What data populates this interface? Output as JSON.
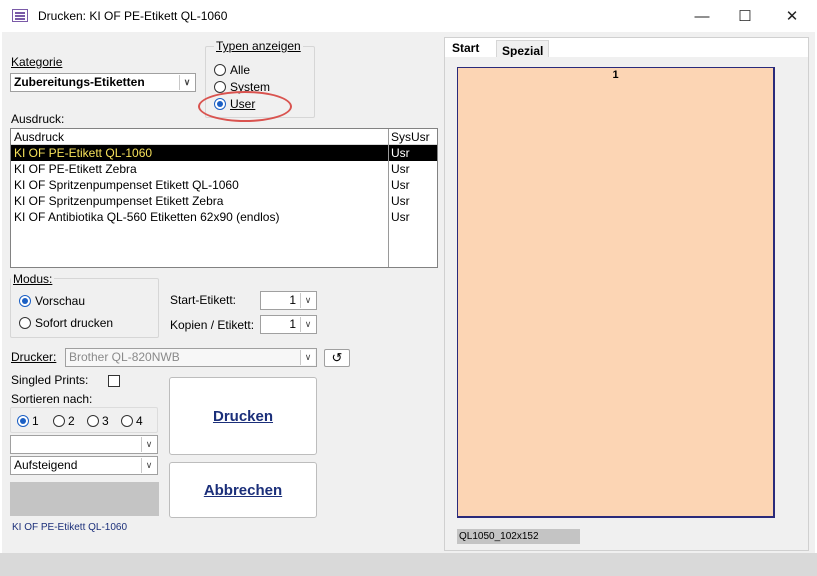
{
  "window": {
    "title": "Drucken: KI OF PE-Etikett QL-1060",
    "minimize_glyph": "—",
    "maximize_glyph": "☐",
    "close_glyph": "✕"
  },
  "kategorie": {
    "label": "Kategorie",
    "value": "Zubereitungs-Etiketten"
  },
  "typen": {
    "label": "Typen anzeigen",
    "options": [
      "Alle",
      "System",
      "User"
    ],
    "selected": "User"
  },
  "ausdruck": {
    "label": "Ausdruck:",
    "columns": [
      "Ausdruck",
      "SysUsr"
    ],
    "rows": [
      {
        "name": "KI OF PE-Etikett QL-1060",
        "sys": "Usr"
      },
      {
        "name": "KI OF PE-Etikett Zebra",
        "sys": "Usr"
      },
      {
        "name": "KI OF Spritzenpumpenset Etikett QL-1060",
        "sys": "Usr"
      },
      {
        "name": "KI OF Spritzenpumpenset Etikett Zebra",
        "sys": "Usr"
      },
      {
        "name": "KI OF Antibiotika QL-560 Etiketten 62x90 (endlos)",
        "sys": "Usr"
      }
    ],
    "selected_index": 0
  },
  "modus": {
    "label": "Modus:",
    "options": [
      "Vorschau",
      "Sofort drucken"
    ],
    "selected": "Vorschau"
  },
  "start_etikett": {
    "label": "Start-Etikett:",
    "value": "1"
  },
  "kopien": {
    "label": "Kopien / Etikett:",
    "value": "1"
  },
  "drucker": {
    "label": "Drucker:",
    "value": "Brother QL-820NWB",
    "refresh_glyph": "↺"
  },
  "singled_prints": {
    "label": "Singled Prints:",
    "checked": false
  },
  "sortieren": {
    "label": "Sortieren nach:",
    "options": [
      "1",
      "2",
      "3",
      "4"
    ],
    "selected": "1",
    "field_value": "",
    "order_value": "Aufsteigend"
  },
  "buttons": {
    "drucken": "Drucken",
    "abbrechen": "Abbrechen"
  },
  "status_text": "KI OF PE-Etikett QL-1060",
  "preview": {
    "tabs": [
      "Start",
      "Spezial"
    ],
    "active_tab": "Start",
    "page_number": "1",
    "label_format": "QL1050_102x152",
    "label_color": "#fcd5b4",
    "label_border": "#2a2a7a"
  },
  "colors": {
    "highlight_ring": "#d9534f",
    "link_blue": "#1b2f7a"
  }
}
